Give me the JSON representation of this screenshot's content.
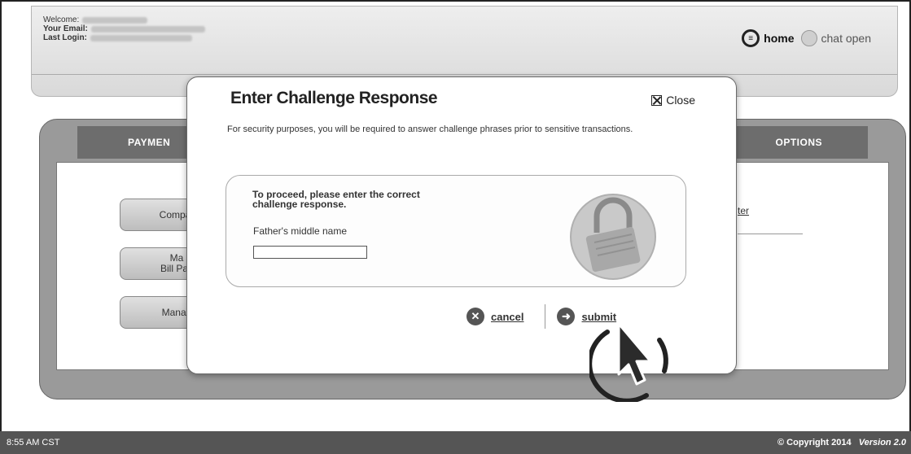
{
  "header": {
    "welcome_label": "Welcome:",
    "email_label": "Your Email:",
    "last_login_label": "Last Login:",
    "home_label": "home",
    "chat_label": "chat open"
  },
  "main": {
    "tab_left": "PAYMEN",
    "tab_right": "OPTIONS",
    "buttons": [
      "Compar",
      "Ma\nBill Pay",
      "Manag"
    ],
    "link_right": "ter"
  },
  "modal": {
    "title": "Enter Challenge Response",
    "close_label": "Close",
    "description": "For security purposes, you will be required to answer challenge phrases prior to sensitive transactions.",
    "instruction": "To proceed, please enter the correct challenge response.",
    "question": "Father's middle name",
    "answer_value": "",
    "cancel_label": "cancel",
    "submit_label": "submit",
    "icons": {
      "close": "close-box-icon",
      "lock": "padlock-icon",
      "cancel": "x-circle-icon",
      "submit": "arrow-circle-icon"
    }
  },
  "footer": {
    "time": "8:55 AM CST",
    "copyright": "© Copyright 2014",
    "version": "Version 2.0"
  }
}
